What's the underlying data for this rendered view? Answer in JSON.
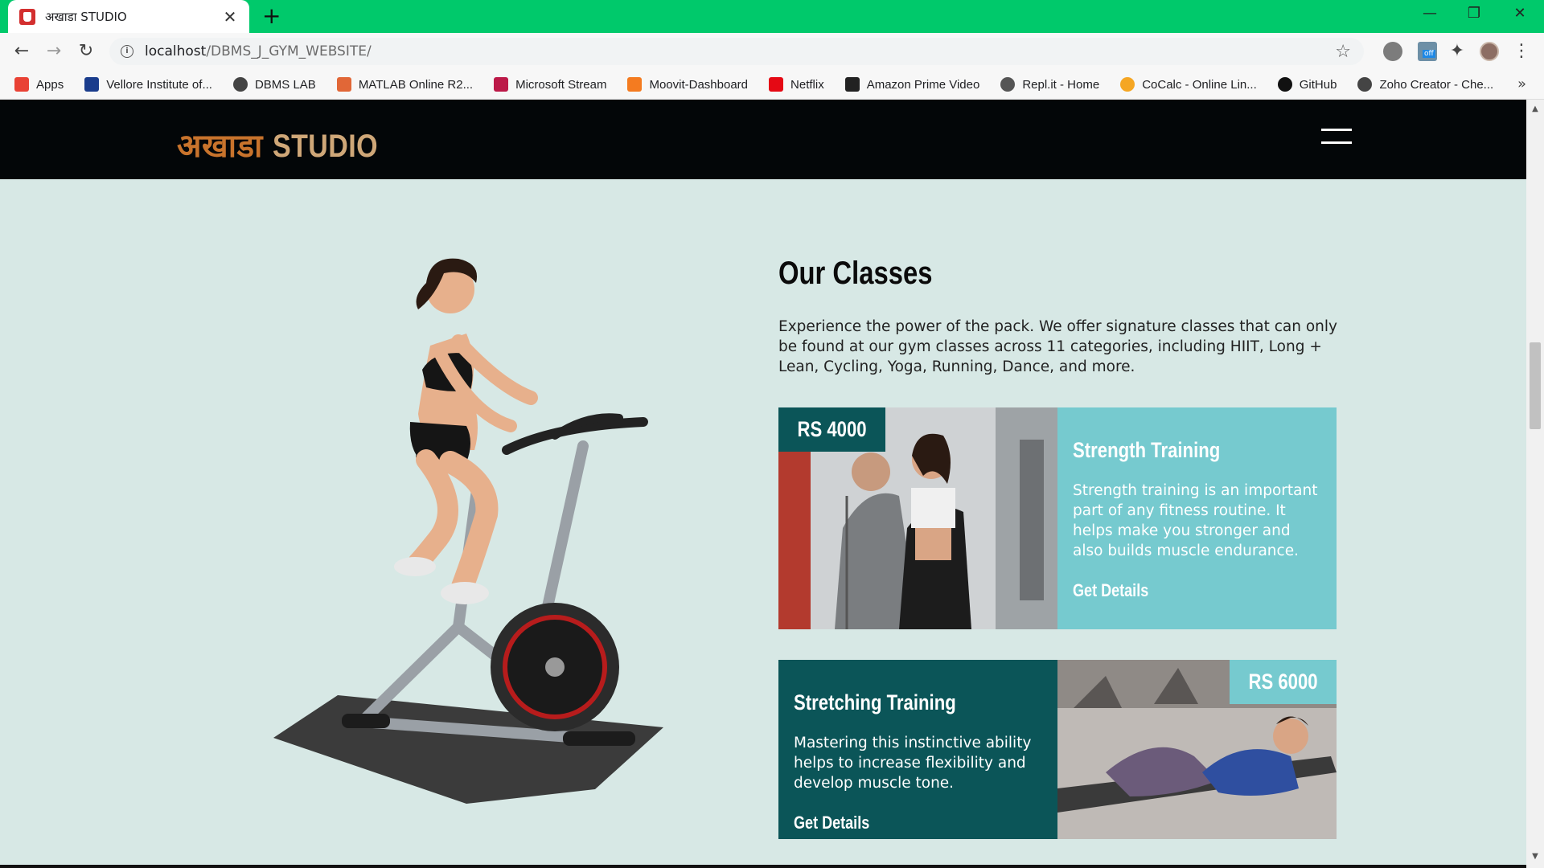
{
  "browser": {
    "tab_title": "अखाडा STUDIO",
    "tab_close": "✕",
    "new_tab": "+",
    "window_controls": {
      "minimize": "—",
      "restore": "❐",
      "close": "✕"
    },
    "nav": {
      "back": "←",
      "forward": "→",
      "reload": "↻"
    },
    "url_host": "localhost",
    "url_path": "/DBMS_J_GYM_WEBSITE/",
    "info_icon": "i",
    "star": "☆",
    "extension_off_badge": "off",
    "puzzle": "✦",
    "menu": "⋮",
    "bookmarks": [
      {
        "label": "Apps",
        "icon": "apps-grid-icon",
        "color": "#e94235"
      },
      {
        "label": "Vellore Institute of...",
        "icon": "vit-icon",
        "color": "#1a3c8c"
      },
      {
        "label": "DBMS LAB",
        "icon": "globe-icon",
        "color": "#444444"
      },
      {
        "label": "MATLAB Online R2...",
        "icon": "matlab-icon",
        "color": "#e16737"
      },
      {
        "label": "Microsoft Stream",
        "icon": "stream-icon",
        "color": "#bc1948"
      },
      {
        "label": "Moovit-Dashboard",
        "icon": "moovit-icon",
        "color": "#f47b20"
      },
      {
        "label": "Netflix",
        "icon": "netflix-icon",
        "color": "#e50914"
      },
      {
        "label": "Amazon Prime Video",
        "icon": "amazon-icon",
        "color": "#222222"
      },
      {
        "label": "Repl.it - Home",
        "icon": "replit-icon",
        "color": "#555555"
      },
      {
        "label": "CoCalc - Online Lin...",
        "icon": "cocalc-icon",
        "color": "#f5a623"
      },
      {
        "label": "GitHub",
        "icon": "github-icon",
        "color": "#111111"
      },
      {
        "label": "Zoho Creator - Che...",
        "icon": "globe-icon",
        "color": "#444444"
      }
    ],
    "bookmarks_more": "»"
  },
  "site": {
    "logo_devanagari": "अखाडा",
    "logo_english": "STUDIO",
    "colors": {
      "header_bg": "#030608",
      "page_bg": "#d7e8e5",
      "teal_light": "#76cacf",
      "teal_dark": "#0b5558",
      "logo_orange": "#c8732c",
      "logo_tan": "#cfa778"
    }
  },
  "classes": {
    "title": "Our Classes",
    "description": "Experience the power of the pack. We offer signature classes that can only be found at our gym classes across 11 categories, including HIIT, Long + Lean, Cycling, Yoga, Running, Dance, and more.",
    "cards": [
      {
        "price": "RS 4000",
        "title": "Strength Training",
        "text": "Strength training is an important part of any fitness routine. It helps make you stronger and also builds muscle endurance.",
        "link": "Get Details"
      },
      {
        "price": "RS 6000",
        "title": "Stretching Training",
        "text": "Mastering this instinctive ability helps to increase flexibility and develop muscle tone.",
        "link": "Get Details"
      }
    ]
  }
}
